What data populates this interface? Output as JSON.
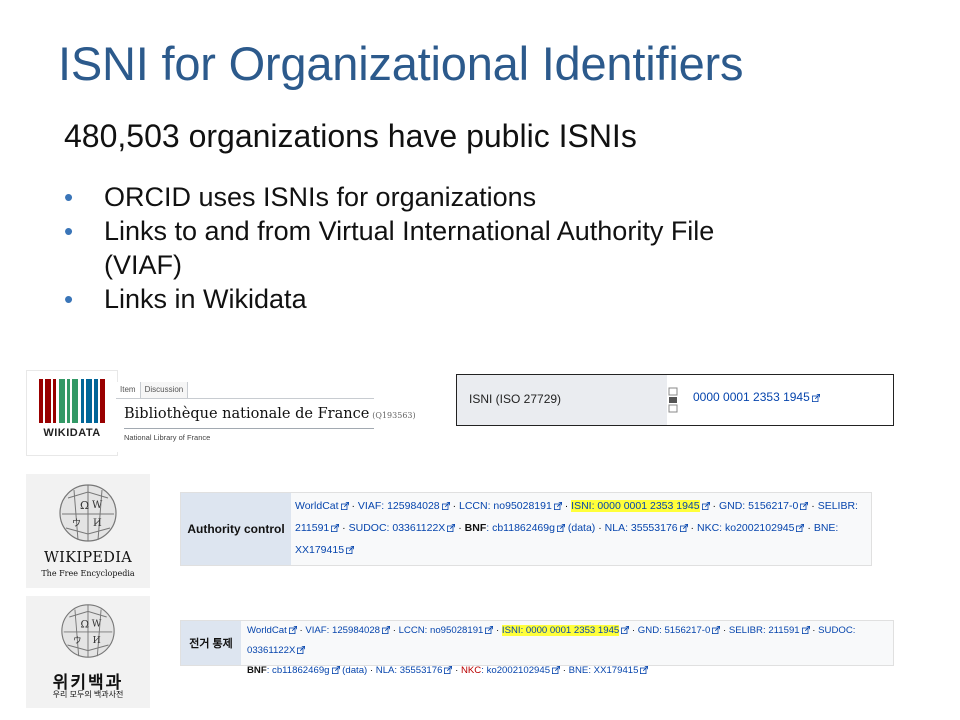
{
  "slide": {
    "title": "ISNI for Organizational Identifiers",
    "subtitle": "480,503 organizations have public ISNIs",
    "bullets": [
      "ORCID uses ISNIs for organizations",
      "Links to and from Virtual International Authority File (VIAF)",
      "Links in Wikidata"
    ],
    "bullet_glyph": "•",
    "title_color": "#2c5a8c",
    "bullet_color": "#3a75b8"
  },
  "wikidata": {
    "logo_word": "WIKIDATA",
    "tabs": [
      "Item",
      "Discussion"
    ],
    "label": "Bibliothèque nationale de France",
    "qid": "(Q193563)",
    "description": "National Library of France"
  },
  "isni_statement": {
    "property": "ISNI (ISO 27729)",
    "value": "0000 0001 2353 1945"
  },
  "wikipedia_en": {
    "logo_word": "WIKIPEDIA",
    "tagline": "The Free Encyclopedia",
    "authority_label": "Authority control",
    "lines": [
      {
        "a": "WorldCat",
        "b": "VIAF: 125984028",
        "c": "LCCN: no95028191",
        "d": "ISNI: 0000 0001 2353 1945",
        "e": "GND: 5156217-0",
        "f": "SELIBR:"
      },
      {
        "a": "211591",
        "b": "SUDOC: 03361122X",
        "c": "BNF",
        "d": ": cb11862469g",
        "e": "(data)",
        "f": "NLA: 35553176",
        "g": "NKC: ko2002102945",
        "h": "BNE:"
      },
      {
        "a": "XX179415"
      }
    ]
  },
  "wikipedia_ko": {
    "logo_word": "위키백과",
    "tagline": "우리 모두의 백과사전",
    "authority_label": "전거 통제",
    "lines": [
      {
        "a": "WorldCat",
        "b": "VIAF: 125984028",
        "c": "LCCN: no95028191",
        "d": "ISNI: 0000 0001 2353 1945",
        "e": "GND: 5156217-0",
        "f": "SELIBR: 211591",
        "g": "SUDOC: 03361122X"
      },
      {
        "a": "BNF",
        "b": ": cb11862469g",
        "c": "(data)",
        "d": "NLA: 35553176",
        "e": "NKC",
        "f": ": ko2002102945",
        "g": "BNE: XX179415"
      }
    ]
  },
  "colors": {
    "link": "#0645ad",
    "redlink": "#ba0000",
    "highlight": "#ffff3a",
    "ac_header": "#dde5f0"
  }
}
